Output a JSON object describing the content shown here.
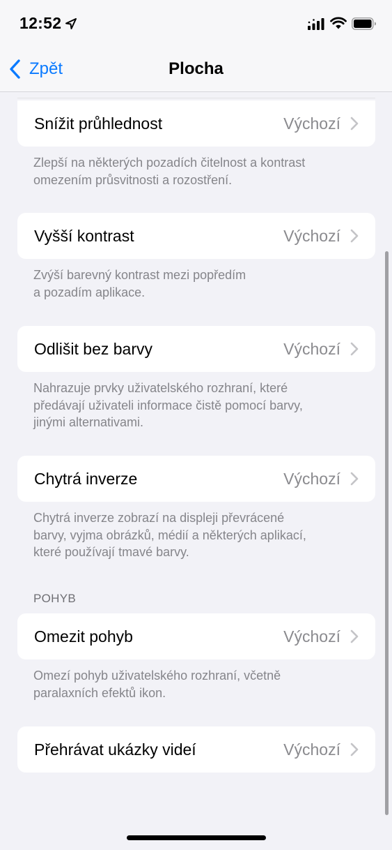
{
  "status_bar": {
    "time": "12:52"
  },
  "nav": {
    "back_label": "Zpět",
    "title": "Plocha"
  },
  "rows": [
    {
      "label": "Snížit průhlednost",
      "value": "Výchozí"
    },
    {
      "label": "Vyšší kontrast",
      "value": "Výchozí"
    },
    {
      "label": "Odlišit bez barvy",
      "value": "Výchozí"
    },
    {
      "label": "Chytrá inverze",
      "value": "Výchozí"
    },
    {
      "label": "Omezit pohyb",
      "value": "Výchozí"
    },
    {
      "label": "Přehrávat ukázky videí",
      "value": "Výchozí"
    }
  ],
  "footers": [
    [
      "Zlepší na některých pozadích čitelnost a kontrast",
      "omezením průsvitnosti a rozostření."
    ],
    [
      "Zvýší barevný kontrast mezi popředím",
      "a pozadím aplikace."
    ],
    [
      "Nahrazuje prvky uživatelského rozhraní, které",
      "předávají uživateli informace čistě pomocí barvy,",
      "jinými alternativami."
    ],
    [
      "Chytrá inverze zobrazí na displeji převrácené",
      "barvy, vyjma obrázků, médií a některých aplikací,",
      "které používají tmavé barvy."
    ],
    [
      "Omezí pohyb uživatelského rozhraní, včetně",
      "paralaxních efektů ikon."
    ]
  ],
  "sections": {
    "motion_header": "POHYB"
  },
  "colors": {
    "accent": "#0a7aff",
    "background": "#f2f2f7",
    "secondary_text": "#8a8a8e"
  },
  "icons": [
    "location-arrow-icon",
    "cellular-signal-icon",
    "wifi-icon",
    "battery-icon",
    "chevron-left-icon",
    "chevron-right-icon"
  ]
}
